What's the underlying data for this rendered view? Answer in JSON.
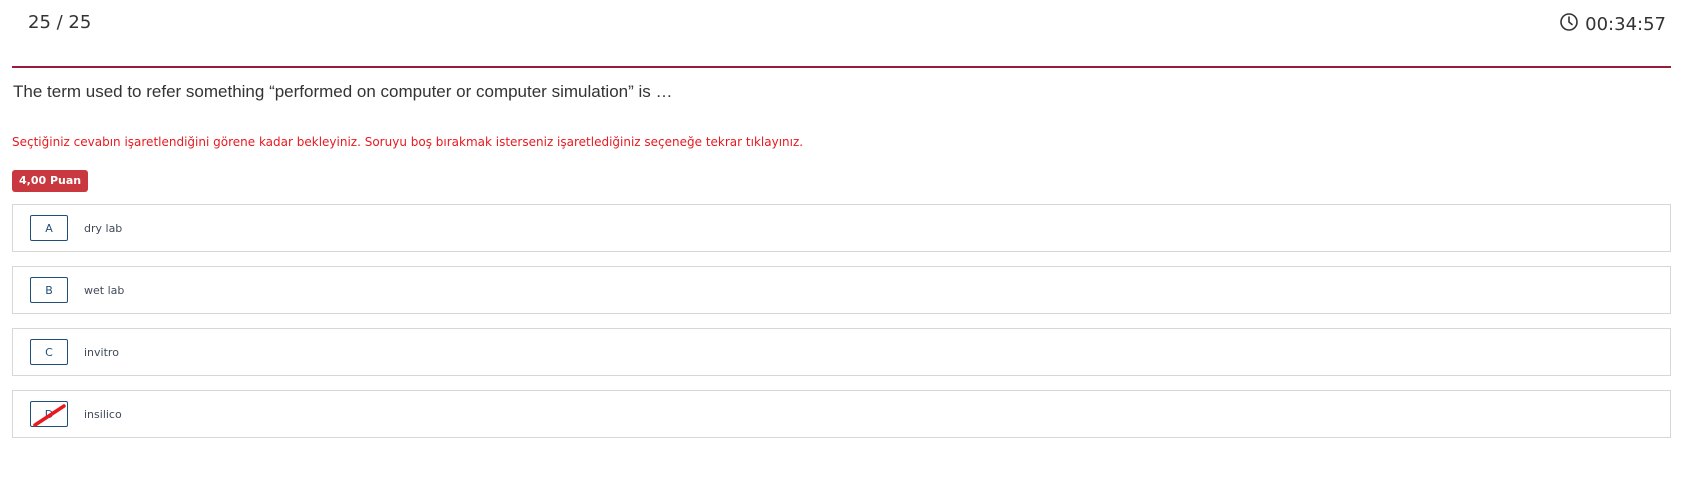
{
  "header": {
    "counter": "25 / 25",
    "timer": "00:34:57",
    "timer_icon": "clock-icon"
  },
  "question": {
    "text": "The term used to refer something “performed on computer or computer simulation” is …",
    "warning": "Seçtiğiniz cevabın işaretlendiğini görene kadar bekleyiniz. Soruyu boş bırakmak isterseniz işaretlediğiniz seçeneğe tekrar tıklayınız.",
    "points": "4,00 Puan"
  },
  "options": [
    {
      "letter": "A",
      "text": "dry lab"
    },
    {
      "letter": "B",
      "text": "wet lab"
    },
    {
      "letter": "C",
      "text": "invitro"
    },
    {
      "letter": "D",
      "text": "insilico",
      "selected_mark": "red-strike"
    }
  ],
  "colors": {
    "accent_line": "#9b1b3a",
    "warning": "#e8191f",
    "badge": "#c9373f",
    "letter_border": "#1f4e79",
    "strike": "#e8191f"
  }
}
